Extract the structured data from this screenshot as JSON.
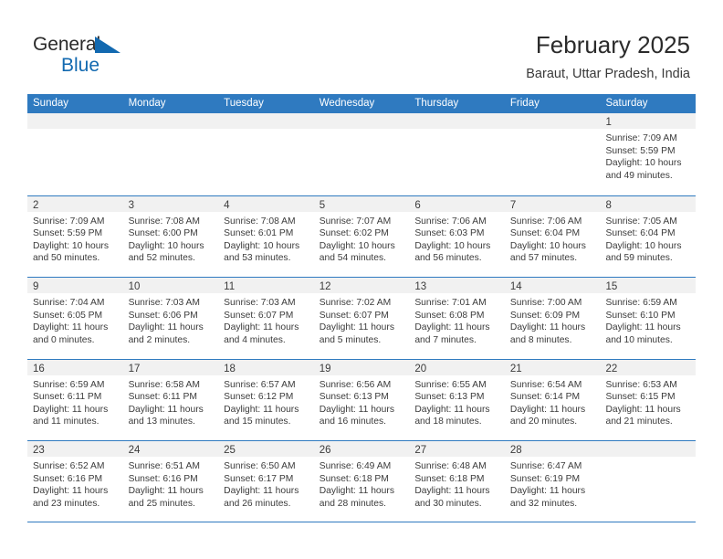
{
  "logo": {
    "text_top": "General",
    "text_bottom": "Blue",
    "triangle_icon": "blue-triangle-icon",
    "brand_color": "#1269b0"
  },
  "header": {
    "title": "February 2025",
    "subtitle": "Baraut, Uttar Pradesh, India"
  },
  "colors": {
    "header_blue": "#2f7ac0",
    "day_band_gray": "#f1f1f1",
    "text": "#3b3b3b"
  },
  "weekdays": [
    "Sunday",
    "Monday",
    "Tuesday",
    "Wednesday",
    "Thursday",
    "Friday",
    "Saturday"
  ],
  "weeks": [
    [
      {
        "day": "",
        "lines": []
      },
      {
        "day": "",
        "lines": []
      },
      {
        "day": "",
        "lines": []
      },
      {
        "day": "",
        "lines": []
      },
      {
        "day": "",
        "lines": []
      },
      {
        "day": "",
        "lines": []
      },
      {
        "day": "1",
        "lines": [
          "Sunrise: 7:09 AM",
          "Sunset: 5:59 PM",
          "Daylight: 10 hours",
          "and 49 minutes."
        ]
      }
    ],
    [
      {
        "day": "2",
        "lines": [
          "Sunrise: 7:09 AM",
          "Sunset: 5:59 PM",
          "Daylight: 10 hours",
          "and 50 minutes."
        ]
      },
      {
        "day": "3",
        "lines": [
          "Sunrise: 7:08 AM",
          "Sunset: 6:00 PM",
          "Daylight: 10 hours",
          "and 52 minutes."
        ]
      },
      {
        "day": "4",
        "lines": [
          "Sunrise: 7:08 AM",
          "Sunset: 6:01 PM",
          "Daylight: 10 hours",
          "and 53 minutes."
        ]
      },
      {
        "day": "5",
        "lines": [
          "Sunrise: 7:07 AM",
          "Sunset: 6:02 PM",
          "Daylight: 10 hours",
          "and 54 minutes."
        ]
      },
      {
        "day": "6",
        "lines": [
          "Sunrise: 7:06 AM",
          "Sunset: 6:03 PM",
          "Daylight: 10 hours",
          "and 56 minutes."
        ]
      },
      {
        "day": "7",
        "lines": [
          "Sunrise: 7:06 AM",
          "Sunset: 6:04 PM",
          "Daylight: 10 hours",
          "and 57 minutes."
        ]
      },
      {
        "day": "8",
        "lines": [
          "Sunrise: 7:05 AM",
          "Sunset: 6:04 PM",
          "Daylight: 10 hours",
          "and 59 minutes."
        ]
      }
    ],
    [
      {
        "day": "9",
        "lines": [
          "Sunrise: 7:04 AM",
          "Sunset: 6:05 PM",
          "Daylight: 11 hours",
          "and 0 minutes."
        ]
      },
      {
        "day": "10",
        "lines": [
          "Sunrise: 7:03 AM",
          "Sunset: 6:06 PM",
          "Daylight: 11 hours",
          "and 2 minutes."
        ]
      },
      {
        "day": "11",
        "lines": [
          "Sunrise: 7:03 AM",
          "Sunset: 6:07 PM",
          "Daylight: 11 hours",
          "and 4 minutes."
        ]
      },
      {
        "day": "12",
        "lines": [
          "Sunrise: 7:02 AM",
          "Sunset: 6:07 PM",
          "Daylight: 11 hours",
          "and 5 minutes."
        ]
      },
      {
        "day": "13",
        "lines": [
          "Sunrise: 7:01 AM",
          "Sunset: 6:08 PM",
          "Daylight: 11 hours",
          "and 7 minutes."
        ]
      },
      {
        "day": "14",
        "lines": [
          "Sunrise: 7:00 AM",
          "Sunset: 6:09 PM",
          "Daylight: 11 hours",
          "and 8 minutes."
        ]
      },
      {
        "day": "15",
        "lines": [
          "Sunrise: 6:59 AM",
          "Sunset: 6:10 PM",
          "Daylight: 11 hours",
          "and 10 minutes."
        ]
      }
    ],
    [
      {
        "day": "16",
        "lines": [
          "Sunrise: 6:59 AM",
          "Sunset: 6:11 PM",
          "Daylight: 11 hours",
          "and 11 minutes."
        ]
      },
      {
        "day": "17",
        "lines": [
          "Sunrise: 6:58 AM",
          "Sunset: 6:11 PM",
          "Daylight: 11 hours",
          "and 13 minutes."
        ]
      },
      {
        "day": "18",
        "lines": [
          "Sunrise: 6:57 AM",
          "Sunset: 6:12 PM",
          "Daylight: 11 hours",
          "and 15 minutes."
        ]
      },
      {
        "day": "19",
        "lines": [
          "Sunrise: 6:56 AM",
          "Sunset: 6:13 PM",
          "Daylight: 11 hours",
          "and 16 minutes."
        ]
      },
      {
        "day": "20",
        "lines": [
          "Sunrise: 6:55 AM",
          "Sunset: 6:13 PM",
          "Daylight: 11 hours",
          "and 18 minutes."
        ]
      },
      {
        "day": "21",
        "lines": [
          "Sunrise: 6:54 AM",
          "Sunset: 6:14 PM",
          "Daylight: 11 hours",
          "and 20 minutes."
        ]
      },
      {
        "day": "22",
        "lines": [
          "Sunrise: 6:53 AM",
          "Sunset: 6:15 PM",
          "Daylight: 11 hours",
          "and 21 minutes."
        ]
      }
    ],
    [
      {
        "day": "23",
        "lines": [
          "Sunrise: 6:52 AM",
          "Sunset: 6:16 PM",
          "Daylight: 11 hours",
          "and 23 minutes."
        ]
      },
      {
        "day": "24",
        "lines": [
          "Sunrise: 6:51 AM",
          "Sunset: 6:16 PM",
          "Daylight: 11 hours",
          "and 25 minutes."
        ]
      },
      {
        "day": "25",
        "lines": [
          "Sunrise: 6:50 AM",
          "Sunset: 6:17 PM",
          "Daylight: 11 hours",
          "and 26 minutes."
        ]
      },
      {
        "day": "26",
        "lines": [
          "Sunrise: 6:49 AM",
          "Sunset: 6:18 PM",
          "Daylight: 11 hours",
          "and 28 minutes."
        ]
      },
      {
        "day": "27",
        "lines": [
          "Sunrise: 6:48 AM",
          "Sunset: 6:18 PM",
          "Daylight: 11 hours",
          "and 30 minutes."
        ]
      },
      {
        "day": "28",
        "lines": [
          "Sunrise: 6:47 AM",
          "Sunset: 6:19 PM",
          "Daylight: 11 hours",
          "and 32 minutes."
        ]
      },
      {
        "day": "",
        "lines": []
      }
    ]
  ]
}
